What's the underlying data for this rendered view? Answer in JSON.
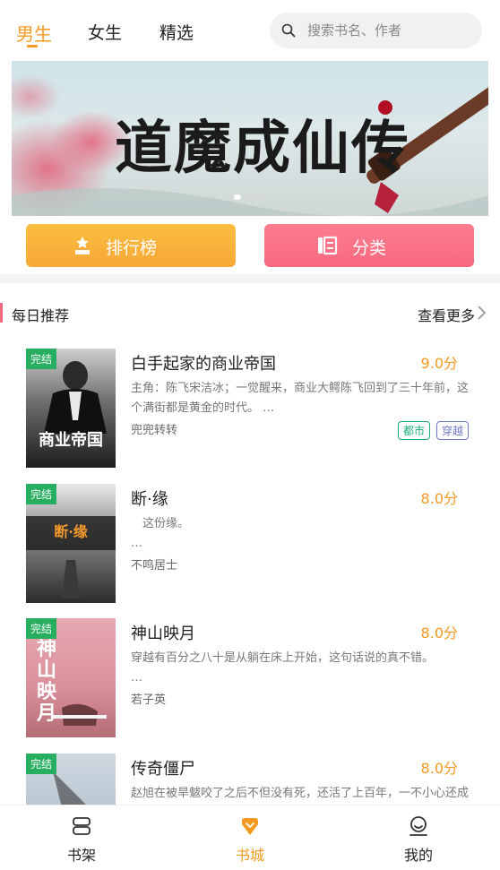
{
  "header": {
    "tabs": [
      {
        "label": "男生",
        "active": true
      },
      {
        "label": "女生",
        "active": false
      },
      {
        "label": "精选",
        "active": false
      }
    ],
    "search": {
      "placeholder": "搜索书名、作者",
      "icon": "search-icon"
    }
  },
  "banner": {
    "title": "道魔成仙传",
    "slides": 3,
    "active_slide": 1
  },
  "quick_actions": [
    {
      "label": "排行榜",
      "icon": "rank-icon",
      "color": "#f9b03a"
    },
    {
      "label": "分类",
      "icon": "category-icon",
      "color": "#fa7386"
    }
  ],
  "section": {
    "title": "每日推荐",
    "more": "查看更多"
  },
  "books": [
    {
      "status": "完结",
      "title": "白手起家的商业帝国",
      "score": "9.0分",
      "desc": "主角：陈飞宋洁冰；一觉醒来，商业大鳄陈飞回到了三十年前，这个满街都是黄金的时代。 …",
      "author": "兜兜转转",
      "tags": [
        "都市",
        "穿越"
      ],
      "cover_text": "商业帝国"
    },
    {
      "status": "完结",
      "title": "断·缘",
      "score": "8.0分",
      "desc": "　这份缘。\n…",
      "author": "不鸣居士",
      "tags": [],
      "cover_text": "断·缘"
    },
    {
      "status": "完结",
      "title": "神山映月",
      "score": "8.0分",
      "desc": "穿越有百分之八十是从躺在床上开始，这句话说的真不错。\n…",
      "author": "若子英",
      "tags": [],
      "cover_text": "神山映月"
    },
    {
      "status": "完结",
      "title": "传奇僵尸",
      "score": "8.0分",
      "desc": "赵旭在被旱魃咬了之后不但没有死，还活了上百年，一不小心还成了僵尸界的老大…看一个僵尸如何在都市当警察，玩暴痕",
      "author": "",
      "tags": [],
      "cover_text": ""
    }
  ],
  "bottom_nav": [
    {
      "label": "书架",
      "icon": "bookshelf-icon",
      "active": false
    },
    {
      "label": "书城",
      "icon": "bookstore-icon",
      "active": true
    },
    {
      "label": "我的",
      "icon": "profile-icon",
      "active": false
    }
  ],
  "colors": {
    "accent": "#f59a23",
    "pink": "#f0687e",
    "green": "#27ae60"
  }
}
